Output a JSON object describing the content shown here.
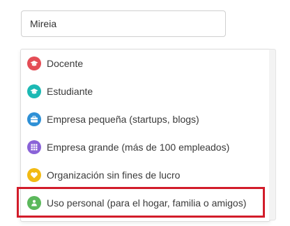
{
  "name_field": {
    "value": "Mireia"
  },
  "options": [
    {
      "label": "Docente",
      "icon": "graduation-cap-icon",
      "color": "#e44d56"
    },
    {
      "label": "Estudiante",
      "icon": "graduation-cap-icon",
      "color": "#1cb9b4"
    },
    {
      "label": "Empresa pequeña (startups, blogs)",
      "icon": "briefcase-icon",
      "color": "#2e90d6"
    },
    {
      "label": "Empresa grande (más de 100 empleados)",
      "icon": "building-icon",
      "color": "#8a63d8"
    },
    {
      "label": "Organización sin fines de lucro",
      "icon": "heart-hand-icon",
      "color": "#f2ba14"
    },
    {
      "label": "Uso personal (para el hogar, familia o amigos)",
      "icon": "people-icon",
      "color": "#5cb85c"
    }
  ],
  "highlight_color": "#d21c2a"
}
